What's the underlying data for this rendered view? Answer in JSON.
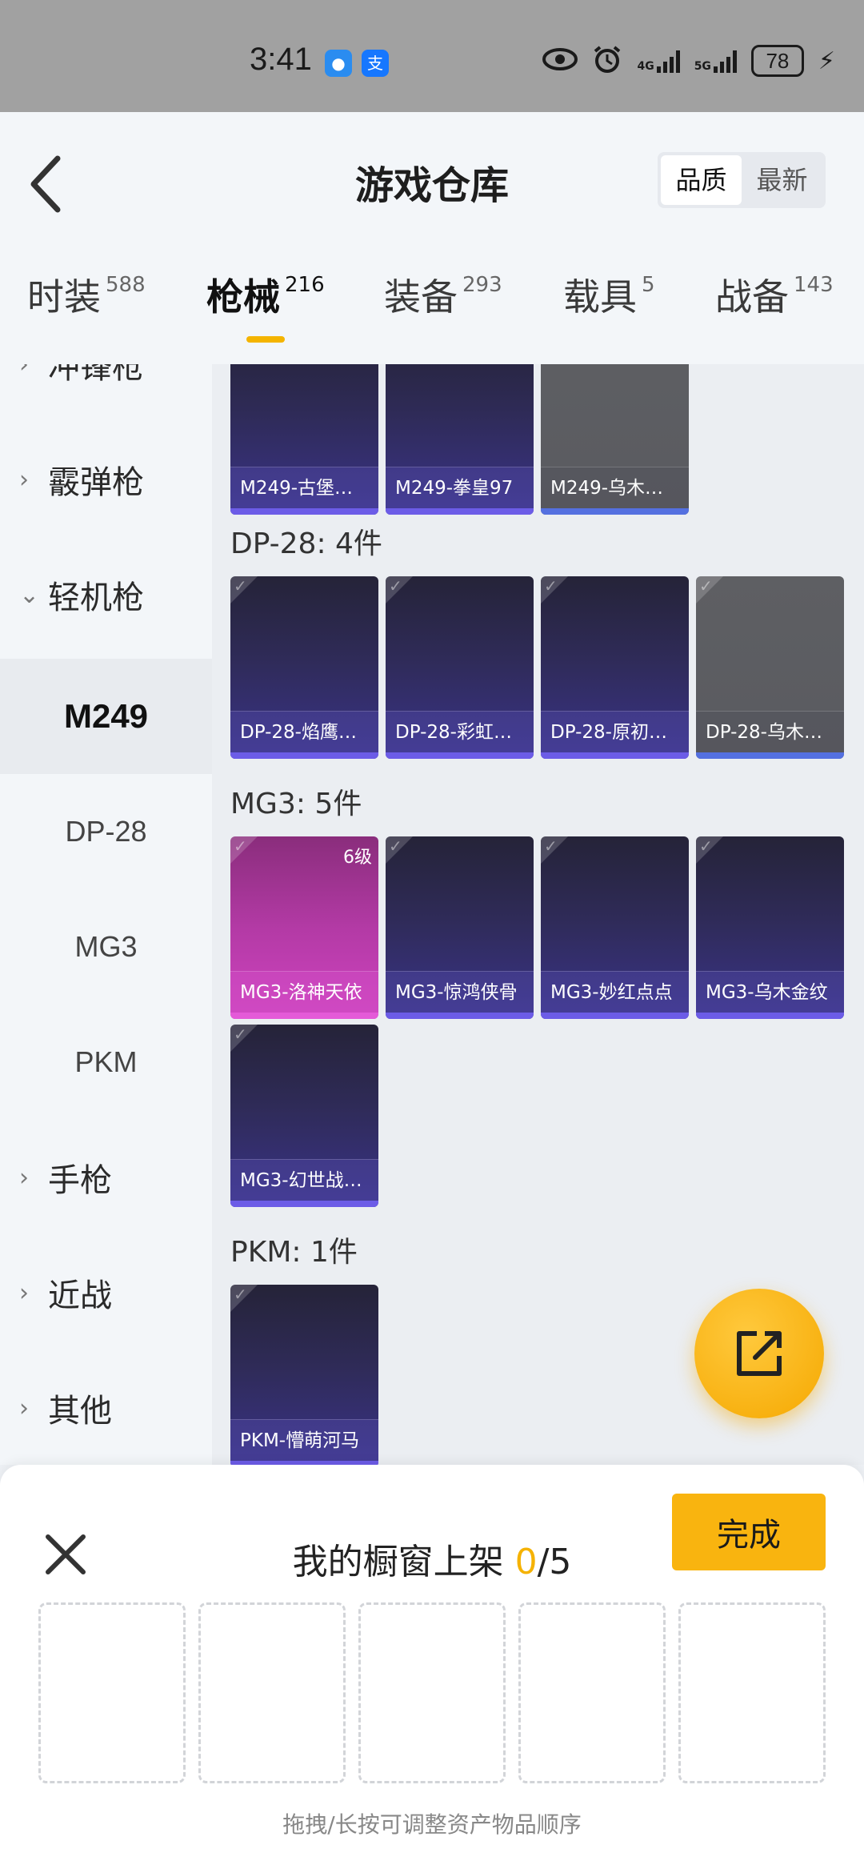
{
  "status_bar": {
    "time": "3:41",
    "apps": [
      "chat-bubble-icon",
      "alipay-icon"
    ],
    "app_labels": [
      "",
      "支"
    ],
    "network_1": "4G",
    "network_2": "5G",
    "battery": "78"
  },
  "header": {
    "title": "游戏仓库",
    "sort_options": [
      "品质",
      "最新"
    ],
    "active_sort": "品质"
  },
  "tabs": [
    {
      "label": "时装",
      "count": "588"
    },
    {
      "label": "枪械",
      "count": "216"
    },
    {
      "label": "装备",
      "count": "293"
    },
    {
      "label": "载具",
      "count": "5"
    },
    {
      "label": "战备",
      "count": "143"
    }
  ],
  "sidebar": {
    "categories": [
      {
        "label": "冲锋枪",
        "chevron": "›"
      },
      {
        "label": "霰弹枪",
        "chevron": "›"
      },
      {
        "label": "轻机枪",
        "chevron": "⌄"
      },
      {
        "label": "手枪",
        "chevron": "›"
      },
      {
        "label": "近战",
        "chevron": "›"
      },
      {
        "label": "其他",
        "chevron": "›"
      }
    ],
    "subitems": [
      "M249",
      "DP-28",
      "MG3",
      "PKM"
    ],
    "active_subitem": "M249"
  },
  "sections": [
    {
      "title": "",
      "items": [
        {
          "name": "M249-古堡…",
          "style": "purple"
        },
        {
          "name": "M249-拳皇97",
          "style": "purple"
        },
        {
          "name": "M249-乌木…",
          "style": "gray"
        }
      ]
    },
    {
      "title": "DP-28: 4件",
      "items": [
        {
          "name": "DP-28-焰鹰…",
          "style": "purple"
        },
        {
          "name": "DP-28-彩虹…",
          "style": "purple"
        },
        {
          "name": "DP-28-原初…",
          "style": "purple"
        },
        {
          "name": "DP-28-乌木…",
          "style": "gray"
        }
      ]
    },
    {
      "title": "MG3: 5件",
      "items": [
        {
          "name": "MG3-洛神天依",
          "style": "pink",
          "level": "6级"
        },
        {
          "name": "MG3-惊鸿侠骨",
          "style": "purple"
        },
        {
          "name": "MG3-妙红点点",
          "style": "purple"
        },
        {
          "name": "MG3-乌木金纹",
          "style": "purple"
        },
        {
          "name": "MG3-幻世战…",
          "style": "purple"
        }
      ]
    },
    {
      "title": "PKM: 1件",
      "items": [
        {
          "name": "PKM-懵萌河马",
          "style": "purple"
        }
      ]
    }
  ],
  "fab": {
    "icon": "share-export-icon"
  },
  "showcase": {
    "title_prefix": "我的橱窗上架 ",
    "current": "0",
    "total": "/5",
    "done_label": "完成",
    "slot_count": 5,
    "hint": "拖拽/长按可调整资产物品顺序"
  },
  "colors": {
    "accent": "#f9b40f",
    "card_purple": "#3a3388",
    "card_pink": "#cf43c0",
    "card_gray": "#5e5f63"
  }
}
